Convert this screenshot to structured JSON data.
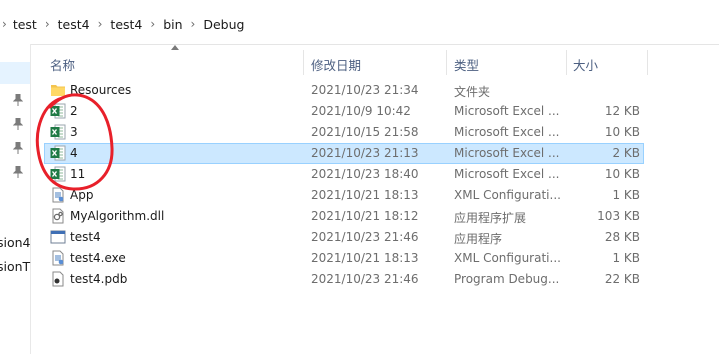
{
  "breadcrumb": {
    "parts": [
      "test",
      "test4",
      "test4",
      "bin",
      "Debug"
    ]
  },
  "left_panel": {
    "labels": [
      "sion4",
      "sionT"
    ]
  },
  "columns": {
    "name": "名称",
    "date": "修改日期",
    "type": "类型",
    "size": "大小"
  },
  "files": [
    {
      "name": "Resources",
      "date": "2021/10/23 21:34",
      "type": "文件夹",
      "size": "",
      "icon": "folder-icon"
    },
    {
      "name": "2",
      "date": "2021/10/9 10:42",
      "type": "Microsoft Excel ...",
      "size": "12 KB",
      "icon": "excel-icon"
    },
    {
      "name": "3",
      "date": "2021/10/15 21:58",
      "type": "Microsoft Excel ...",
      "size": "10 KB",
      "icon": "excel-icon"
    },
    {
      "name": "4",
      "date": "2021/10/23 21:13",
      "type": "Microsoft Excel ...",
      "size": "2 KB",
      "icon": "excel-icon",
      "selected": true
    },
    {
      "name": "11",
      "date": "2021/10/23 18:40",
      "type": "Microsoft Excel ...",
      "size": "10 KB",
      "icon": "excel-icon"
    },
    {
      "name": "App",
      "date": "2021/10/21 18:13",
      "type": "XML Configurati...",
      "size": "1 KB",
      "icon": "config-file-icon"
    },
    {
      "name": "MyAlgorithm.dll",
      "date": "2021/10/21 18:12",
      "type": "应用程序扩展",
      "size": "103 KB",
      "icon": "dll-file-icon"
    },
    {
      "name": "test4",
      "date": "2021/10/23 21:46",
      "type": "应用程序",
      "size": "28 KB",
      "icon": "exe-file-icon"
    },
    {
      "name": "test4.exe",
      "date": "2021/10/21 18:13",
      "type": "XML Configurati...",
      "size": "1 KB",
      "icon": "config-file-icon"
    },
    {
      "name": "test4.pdb",
      "date": "2021/10/23 21:46",
      "type": "Program Debug...",
      "size": "22 KB",
      "icon": "pdb-file-icon"
    }
  ],
  "colors": {
    "selection_bg": "#cce8ff",
    "selection_border": "#99d1ff",
    "annotation_red": "#e8202a",
    "excel_green": "#1f7a45",
    "folder_yellow": "#f3c44f"
  }
}
